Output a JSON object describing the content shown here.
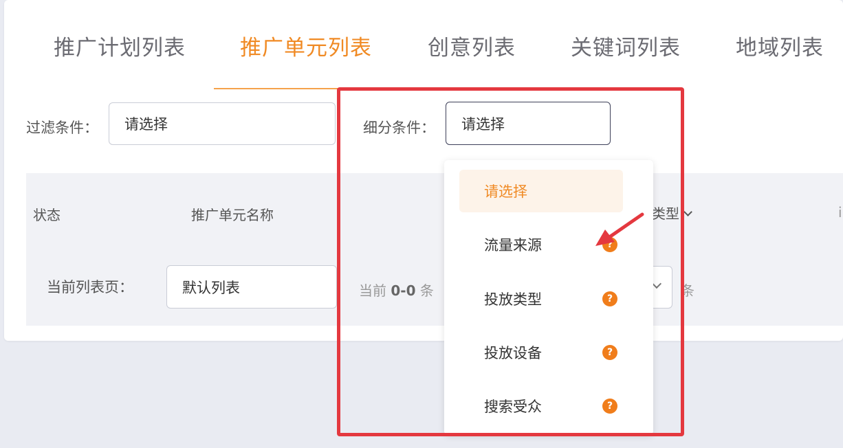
{
  "tabs": [
    {
      "label": "推广计划列表",
      "active": false
    },
    {
      "label": "推广单元列表",
      "active": true
    },
    {
      "label": "创意列表",
      "active": false
    },
    {
      "label": "关键词列表",
      "active": false
    },
    {
      "label": "地域列表",
      "active": false
    }
  ],
  "filters": {
    "filter_label": "过滤条件：",
    "filter_value": "请选择",
    "segment_label": "细分条件：",
    "segment_value": "请选择"
  },
  "table": {
    "col_status": "状态",
    "col_name": "推广单元名称",
    "col_type": "类型",
    "col_cut": "i"
  },
  "pager": {
    "current_page_label": "当前列表页：",
    "current_page_value": "默认列表",
    "summary_prefix": "当前 ",
    "summary_range": "0-0",
    "summary_suffix": " 条",
    "count_suffix": "条"
  },
  "dropdown": {
    "options": [
      {
        "label": "请选择",
        "selected": true,
        "has_help": false
      },
      {
        "label": "流量来源",
        "selected": false,
        "has_help": true
      },
      {
        "label": "投放类型",
        "selected": false,
        "has_help": true
      },
      {
        "label": "投放设备",
        "selected": false,
        "has_help": true
      },
      {
        "label": "搜索受众",
        "selected": false,
        "has_help": true
      }
    ],
    "help_glyph": "?"
  },
  "colors": {
    "accent": "#f08a24",
    "highlight_border": "#e4383f",
    "help_icon": "#f07d1b"
  }
}
